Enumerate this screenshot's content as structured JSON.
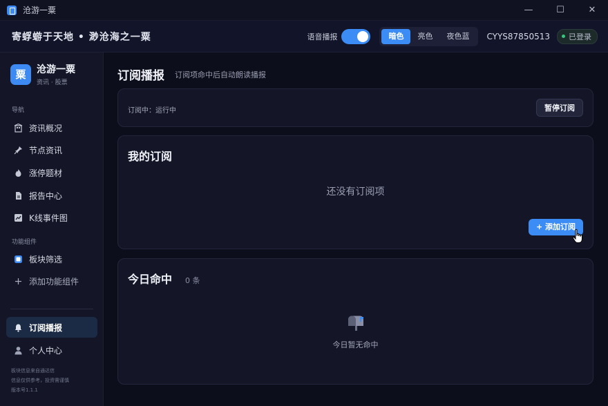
{
  "window": {
    "title": "沧游一粟",
    "minimize": "—",
    "maximize": "☐",
    "close": "✕"
  },
  "header": {
    "slogan": "寄蜉蝣于天地 • 渺沧海之一粟",
    "voice_label": "语音播报",
    "voice_on": true,
    "themes": [
      "暗色",
      "亮色",
      "夜色蓝"
    ],
    "active_theme": "暗色",
    "user_id": "CYYS87850513",
    "login_status": "已登录"
  },
  "sidebar": {
    "brand_logo": "粟",
    "brand_name": "沧游一粟",
    "brand_sub": "资讯 · 股票",
    "nav_label": "导航",
    "nav_items": [
      {
        "label": "资讯概况",
        "icon": "building-icon"
      },
      {
        "label": "节点资讯",
        "icon": "pin-icon"
      },
      {
        "label": "涨停题材",
        "icon": "flame-icon"
      },
      {
        "label": "报告中心",
        "icon": "document-icon"
      },
      {
        "label": "K线事件图",
        "icon": "chart-icon"
      }
    ],
    "widgets_label": "功能组件",
    "widget_items": [
      {
        "label": "板块筛选",
        "icon": "grid-icon"
      },
      {
        "label": "添加功能组件",
        "icon": "plus-icon"
      }
    ],
    "bottom_items": [
      {
        "label": "订阅播报",
        "icon": "bell-icon",
        "active": true
      },
      {
        "label": "个人中心",
        "icon": "user-icon"
      }
    ],
    "footnotes": [
      "板块信息来自通达信",
      "信息仅供参考，投资需谨慎",
      "版本号1.1.1"
    ]
  },
  "main": {
    "title": "订阅播报",
    "subtitle": "订阅项命中后自动朗读播报",
    "status_text": "订阅中：运行中",
    "pause_button": "暂停订阅",
    "my_subs_title": "我的订阅",
    "my_subs_empty": "还没有订阅项",
    "add_button": "+ 添加订阅",
    "today_title": "今日命中",
    "today_count": "0 条",
    "today_empty": "今日暂无命中"
  },
  "colors": {
    "accent": "#3c8cf6",
    "bg": "#0b0c17",
    "card": "#141628",
    "online": "#35c77f"
  }
}
